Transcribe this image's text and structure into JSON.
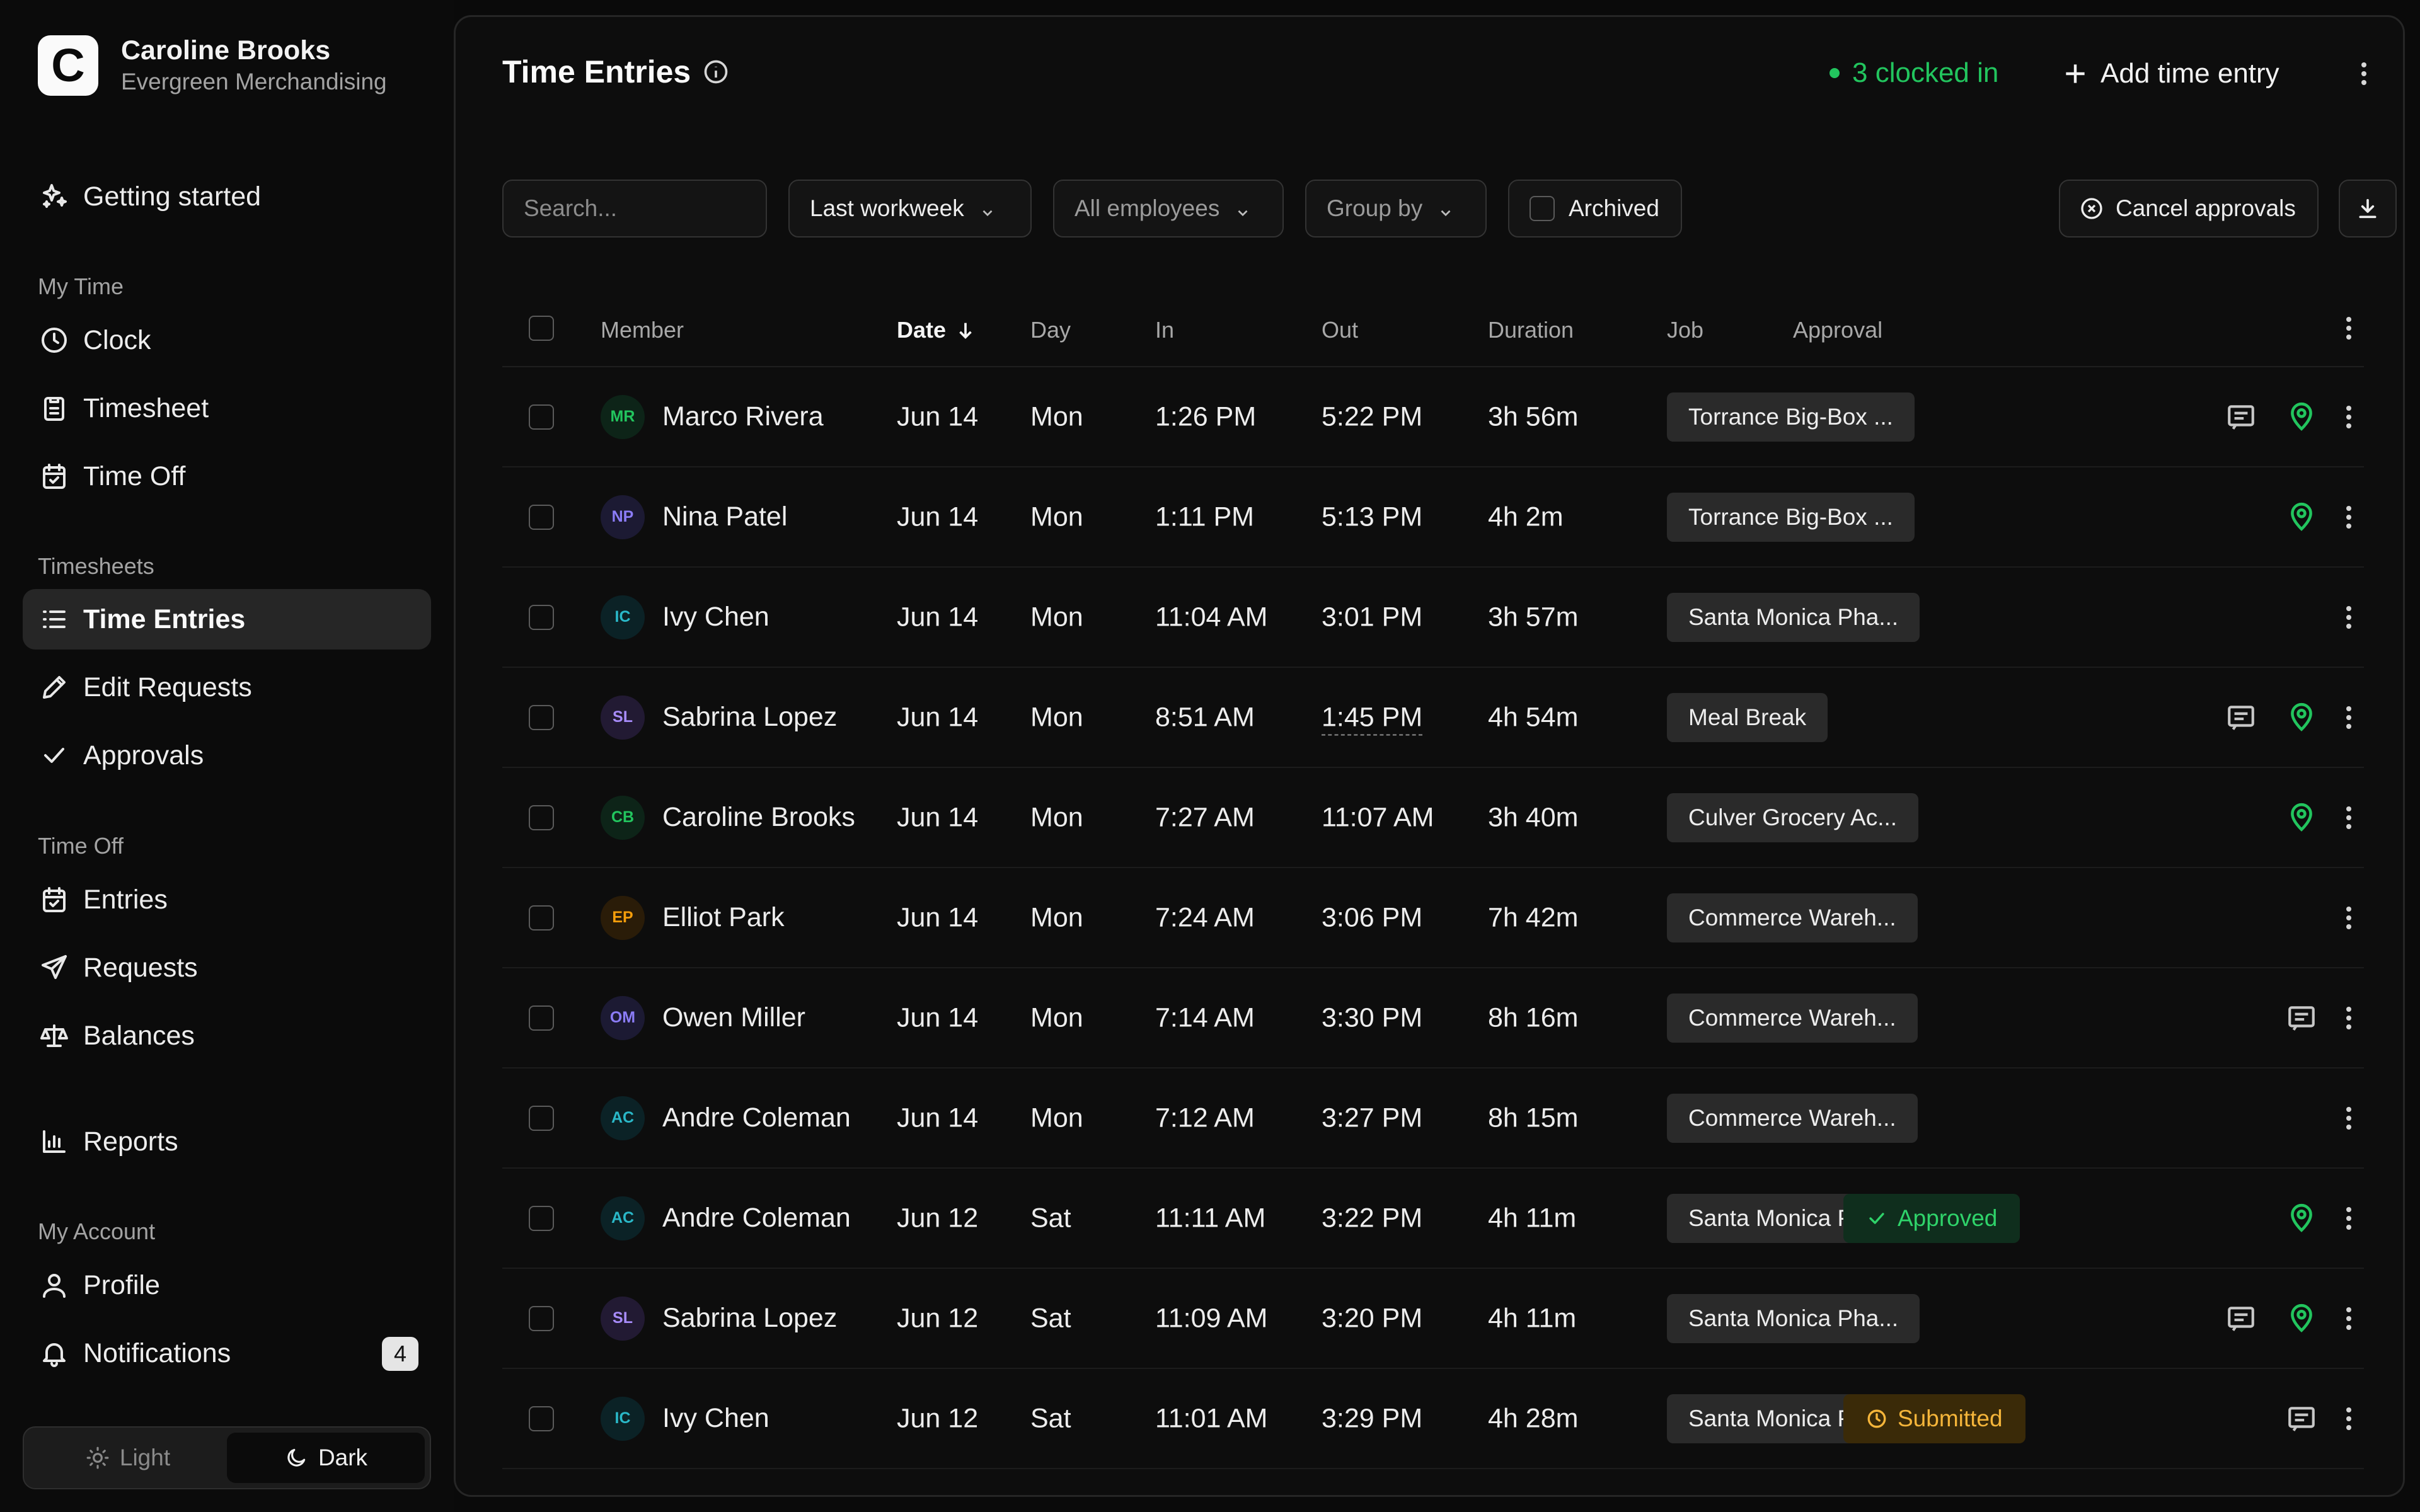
{
  "account": {
    "logo_letter": "C",
    "name": "Caroline Brooks",
    "org": "Evergreen Merchandising"
  },
  "sidebar": {
    "getting_started": "Getting started",
    "sections": {
      "my_time": "My Time",
      "timesheets": "Timesheets",
      "time_off": "Time Off",
      "my_account": "My Account"
    },
    "items": {
      "clock": "Clock",
      "timesheet": "Timesheet",
      "time_off": "Time Off",
      "time_entries": "Time Entries",
      "edit_requests": "Edit Requests",
      "approvals": "Approvals",
      "entries": "Entries",
      "requests": "Requests",
      "balances": "Balances",
      "reports": "Reports",
      "profile": "Profile",
      "notifications": "Notifications"
    },
    "notifications_badge": "4",
    "theme": {
      "light": "Light",
      "dark": "Dark",
      "selected": "Dark"
    }
  },
  "header": {
    "title": "Time Entries",
    "clocked_in": "3 clocked in",
    "add_entry": "Add time entry"
  },
  "filters": {
    "search_placeholder": "Search...",
    "period": "Last workweek",
    "employees": "All employees",
    "group_by": "Group by",
    "archived": "Archived",
    "cancel_approvals": "Cancel approvals"
  },
  "table": {
    "columns": {
      "member": "Member",
      "date": "Date",
      "day": "Day",
      "in": "In",
      "out": "Out",
      "duration": "Duration",
      "job": "Job",
      "approval": "Approval"
    },
    "rows": [
      {
        "initials": "MR",
        "name": "Marco Rivera",
        "date": "Jun 14",
        "day": "Mon",
        "in": "1:26 PM",
        "out": "5:22 PM",
        "duration": "3h 56m",
        "job": "Torrance Big-Box ...",
        "approval": "",
        "note": true,
        "pin": true,
        "avatar_color": "#22c55e",
        "avatar_bg": "#0d2418"
      },
      {
        "initials": "NP",
        "name": "Nina Patel",
        "date": "Jun 14",
        "day": "Mon",
        "in": "1:11 PM",
        "out": "5:13 PM",
        "duration": "4h 2m",
        "job": "Torrance Big-Box ...",
        "approval": "",
        "note": false,
        "pin": true,
        "avatar_color": "#8b7cf6",
        "avatar_bg": "#1c1a33"
      },
      {
        "initials": "IC",
        "name": "Ivy Chen",
        "date": "Jun 14",
        "day": "Mon",
        "in": "11:04 AM",
        "out": "3:01 PM",
        "duration": "3h 57m",
        "job": "Santa Monica Pha...",
        "approval": "",
        "note": false,
        "pin": false,
        "avatar_color": "#2ab8c8",
        "avatar_bg": "#0b2226"
      },
      {
        "initials": "SL",
        "name": "Sabrina Lopez",
        "date": "Jun 14",
        "day": "Mon",
        "in": "8:51 AM",
        "out": "1:45 PM",
        "duration": "4h 54m",
        "job": "Meal Break",
        "approval": "",
        "note": true,
        "pin": true,
        "avatar_color": "#a78bfa",
        "avatar_bg": "#221a33",
        "out_dashed": true
      },
      {
        "initials": "CB",
        "name": "Caroline Brooks",
        "date": "Jun 14",
        "day": "Mon",
        "in": "7:27 AM",
        "out": "11:07 AM",
        "duration": "3h 40m",
        "job": "Culver Grocery Ac...",
        "approval": "",
        "note": false,
        "pin": true,
        "avatar_color": "#22c55e",
        "avatar_bg": "#0d2418"
      },
      {
        "initials": "EP",
        "name": "Elliot Park",
        "date": "Jun 14",
        "day": "Mon",
        "in": "7:24 AM",
        "out": "3:06 PM",
        "duration": "7h 42m",
        "job": "Commerce Wareh...",
        "approval": "",
        "note": false,
        "pin": false,
        "avatar_color": "#f59e0b",
        "avatar_bg": "#2a1c08"
      },
      {
        "initials": "OM",
        "name": "Owen Miller",
        "date": "Jun 14",
        "day": "Mon",
        "in": "7:14 AM",
        "out": "3:30 PM",
        "duration": "8h 16m",
        "job": "Commerce Wareh...",
        "approval": "",
        "note": true,
        "pin": false,
        "avatar_color": "#8b7cf6",
        "avatar_bg": "#1c1a33"
      },
      {
        "initials": "AC",
        "name": "Andre Coleman",
        "date": "Jun 14",
        "day": "Mon",
        "in": "7:12 AM",
        "out": "3:27 PM",
        "duration": "8h 15m",
        "job": "Commerce Wareh...",
        "approval": "",
        "note": false,
        "pin": false,
        "avatar_color": "#2ab8c8",
        "avatar_bg": "#0b2226"
      },
      {
        "initials": "AC",
        "name": "Andre Coleman",
        "date": "Jun 12",
        "day": "Sat",
        "in": "11:11 AM",
        "out": "3:22 PM",
        "duration": "4h 11m",
        "job": "Santa Monica Pha...",
        "approval": "Approved",
        "note": false,
        "pin": true,
        "avatar_color": "#2ab8c8",
        "avatar_bg": "#0b2226"
      },
      {
        "initials": "SL",
        "name": "Sabrina Lopez",
        "date": "Jun 12",
        "day": "Sat",
        "in": "11:09 AM",
        "out": "3:20 PM",
        "duration": "4h 11m",
        "job": "Santa Monica Pha...",
        "approval": "",
        "note": true,
        "pin": true,
        "avatar_color": "#a78bfa",
        "avatar_bg": "#221a33"
      },
      {
        "initials": "IC",
        "name": "Ivy Chen",
        "date": "Jun 12",
        "day": "Sat",
        "in": "11:01 AM",
        "out": "3:29 PM",
        "duration": "4h 28m",
        "job": "Santa Monica Pha...",
        "approval": "Submitted",
        "note": true,
        "pin": false,
        "avatar_color": "#2ab8c8",
        "avatar_bg": "#0b2226"
      }
    ]
  },
  "colors": {
    "accent_green": "#22c55e",
    "approved": "#2fd36a",
    "submitted": "#f5b53a",
    "panel": "#0d0d0d"
  }
}
